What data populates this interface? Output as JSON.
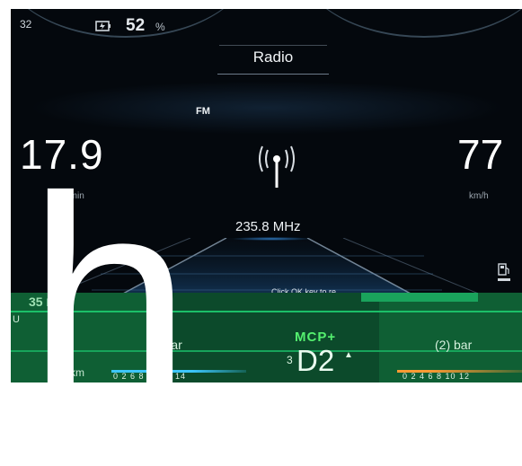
{
  "cluster": {
    "top_left_number": "32",
    "battery": {
      "icon": "battery-charge-icon",
      "value": "52",
      "unit": "%"
    },
    "title": "Radio",
    "band": "FM",
    "rpm": {
      "value": "17.9",
      "unit": "0r/min"
    },
    "speed": {
      "value": "77",
      "unit": "km/h"
    },
    "radio_icon": "radio-antenna-icon",
    "frequency": "235.8 MHz",
    "fuel_icon": "fuel-pump-icon",
    "message": "Click OK key to re...",
    "oil": {
      "value": "35",
      "unit": "bar"
    },
    "left_glyph": "U",
    "tire_left": {
      "value": "(",
      "unit": "bar"
    },
    "tire_right": {
      "value": "(2)",
      "unit": "bar"
    },
    "drive_mode": "MCP+",
    "gear_prefix": "3",
    "gear": "D2",
    "gear_arrow": "▲",
    "km_unit": "km",
    "scale_left": "0  2  6  8  10 12 14",
    "scale_right": "0  2  4  6  8  10 12",
    "overlay_letter": "h",
    "colors": {
      "accent_blue": "#3cc6ff",
      "mode_green": "#54f06f",
      "warning_orange": "#ff9a33"
    }
  }
}
